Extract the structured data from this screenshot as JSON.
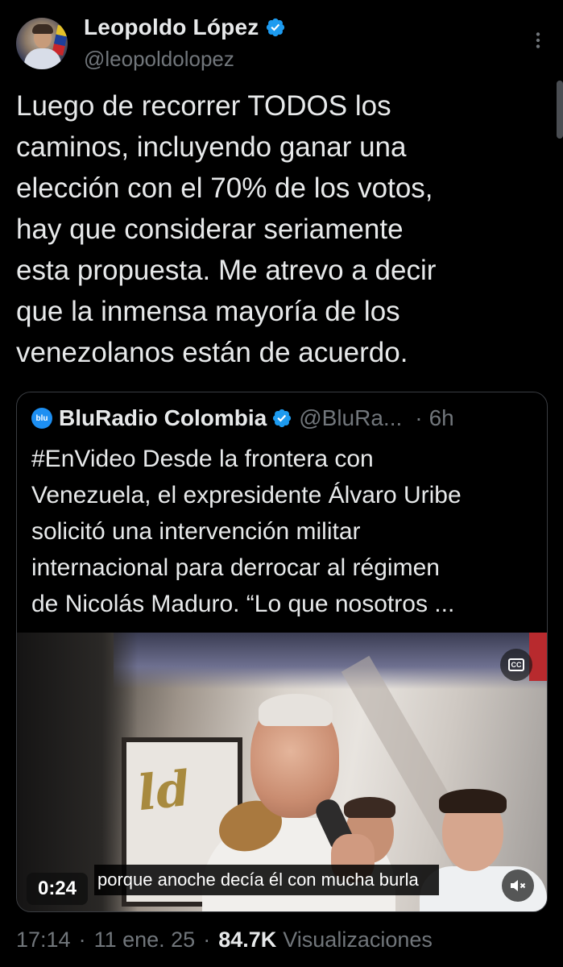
{
  "author": {
    "name": "Leopoldo López",
    "handle": "@leopoldolopez"
  },
  "tweet": {
    "text": "Luego de recorrer TODOS los\ncaminos, incluyendo ganar una\nelección con el 70% de los votos,\nhay que considerar seriamente\nesta propuesta. Me atrevo a decir\nque la inmensa mayoría de los\nvenezolanos están de acuerdo."
  },
  "quoted": {
    "logo_text": "blu",
    "name": "BluRadio Colombia",
    "handle": "@BluRa...",
    "separator": "·",
    "time": "6h",
    "text": "#EnVideo Desde la frontera con\nVenezuela, el expresidente Álvaro Uribe\nsolicitó una intervención militar\ninternacional para derrocar al régimen\nde Nicolás Maduro. “Lo que nosotros ...",
    "video": {
      "duration": "0:24",
      "subtitle": "porque anoche decía él con mucha burla",
      "cc_label": "CC",
      "sign_text": "ld"
    }
  },
  "meta": {
    "time": "17:14",
    "sep1": "·",
    "date": "11 ene. 25",
    "sep2": "·",
    "views_count": "84.7K",
    "views_label": "Visualizaciones"
  },
  "colors": {
    "background": "#000000",
    "text": "#e7e9ea",
    "secondary": "#71767b",
    "verified": "#1d9bf0",
    "border": "#3a3d42"
  }
}
